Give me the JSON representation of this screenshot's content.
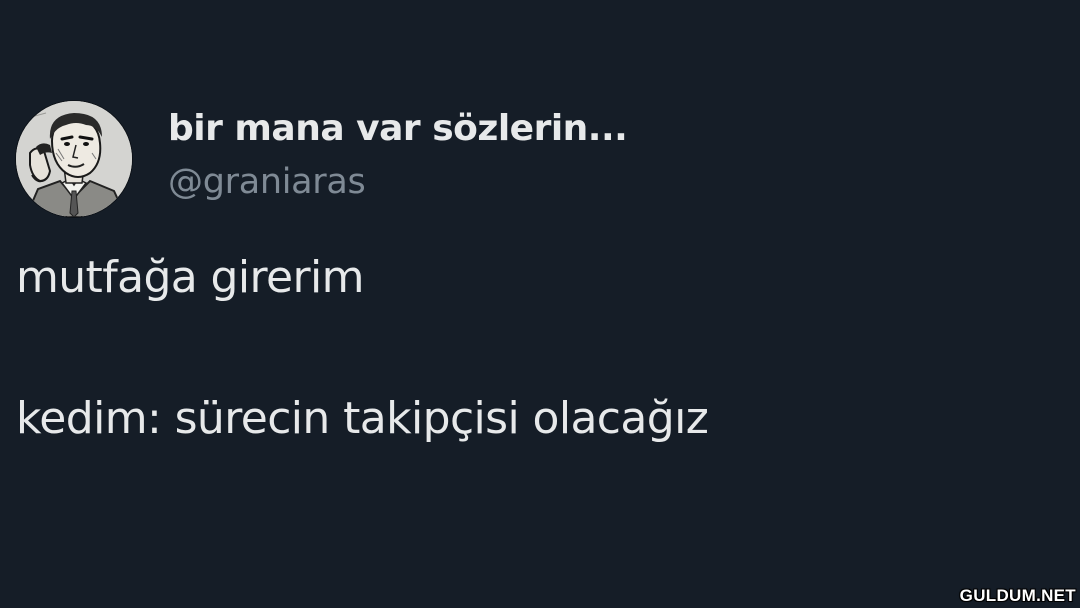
{
  "tweet": {
    "display_name": "bir mana var sözlerin...",
    "handle": "@graniaras",
    "text_lines": [
      "mutfağa girerim",
      "kedim: sürecin takipçisi olacağız"
    ]
  },
  "watermark": "GULDUM.NET",
  "colors": {
    "background": "#151d27",
    "text_primary": "#e7e9ea",
    "text_secondary": "#7f8a95"
  },
  "icons": {
    "avatar": "comic-man-on-phone-avatar"
  }
}
